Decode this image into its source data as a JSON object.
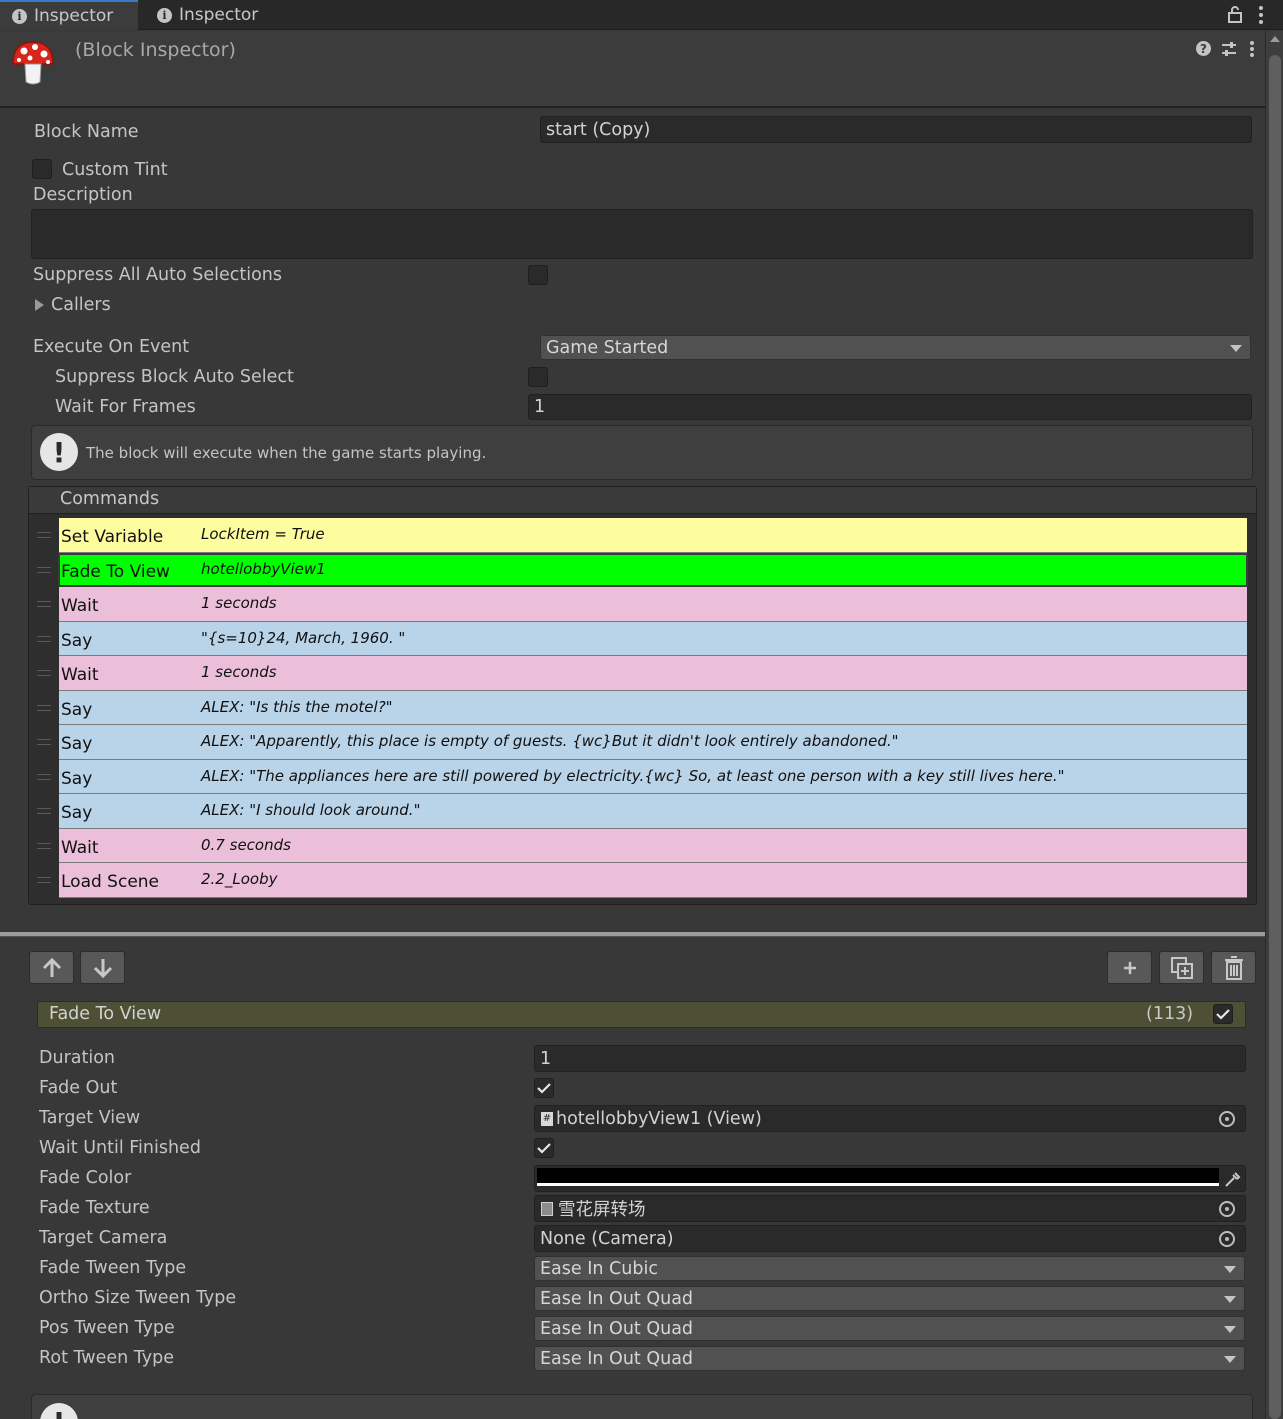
{
  "tabs": [
    {
      "label": "Inspector"
    },
    {
      "label": "Inspector"
    }
  ],
  "header": {
    "title": "(Block Inspector)"
  },
  "block": {
    "block_name_label": "Block Name",
    "block_name_value": "start (Copy)",
    "custom_tint_label": "Custom Tint",
    "description_label": "Description",
    "description_value": "",
    "suppress_all_label": "Suppress All Auto Selections",
    "callers_label": "Callers",
    "execute_on_event_label": "Execute On Event",
    "execute_on_event_value": "Game Started",
    "suppress_block_label": "Suppress Block Auto Select",
    "wait_for_frames_label": "Wait For Frames",
    "wait_for_frames_value": "1",
    "help_text": "The block will execute when the game starts playing."
  },
  "commands": {
    "header": "Commands",
    "rows": [
      {
        "name": "Set Variable",
        "summary": "LockItem = True",
        "color": "#fdfda0"
      },
      {
        "name": "Fade To View",
        "summary": "hotellobbyView1",
        "color": "#00ff00"
      },
      {
        "name": "Wait",
        "summary": "1 seconds",
        "color": "#ebbfd9"
      },
      {
        "name": "Say",
        "summary": "\"{s=10}24, March, 1960. \"",
        "color": "#b9d3e9"
      },
      {
        "name": "Wait",
        "summary": "1 seconds",
        "color": "#ebbfd9"
      },
      {
        "name": "Say",
        "summary": "ALEX: \"Is this the motel?\"",
        "color": "#b9d3e9"
      },
      {
        "name": "Say",
        "summary": "ALEX: \"Apparently, this place is empty of guests. {wc}But it didn't look entirely abandoned.\"",
        "color": "#b9d3e9"
      },
      {
        "name": "Say",
        "summary": "ALEX: \"The appliances here are still powered by electricity.{wc} So, at least one person with a key still lives here.\"",
        "color": "#b9d3e9"
      },
      {
        "name": "Say",
        "summary": "ALEX: \"I should look around.\"",
        "color": "#b9d3e9"
      },
      {
        "name": "Wait",
        "summary": "0.7 seconds",
        "color": "#ebbfd9"
      },
      {
        "name": "Load Scene",
        "summary": "2.2_Looby",
        "color": "#ebbfd9"
      }
    ]
  },
  "selected_command": {
    "title": "Fade To View",
    "index": "(113)",
    "fields": {
      "duration_label": "Duration",
      "duration_value": "1",
      "fade_out_label": "Fade Out",
      "target_view_label": "Target View",
      "target_view_value": "hotellobbyView1 (View)",
      "wait_until_finished_label": "Wait Until Finished",
      "fade_color_label": "Fade Color",
      "fade_color_value": "#000000",
      "fade_texture_label": "Fade Texture",
      "fade_texture_value": "雪花屏转场",
      "target_camera_label": "Target Camera",
      "target_camera_value": "None (Camera)",
      "fade_tween_label": "Fade Tween Type",
      "fade_tween_value": "Ease In Cubic",
      "ortho_tween_label": "Ortho Size Tween Type",
      "ortho_tween_value": "Ease In Out Quad",
      "pos_tween_label": "Pos Tween Type",
      "pos_tween_value": "Ease In Out Quad",
      "rot_tween_label": "Rot Tween Type",
      "rot_tween_value": "Ease In Out Quad"
    }
  },
  "icons": {
    "mushroom": "mushroom-icon",
    "help": "help-icon",
    "presets": "presets-icon",
    "more": "kebab-menu-icon",
    "lock": "lock-icon",
    "up": "arrow-up-icon",
    "down": "arrow-down-icon",
    "add": "plus-icon",
    "duplicate": "duplicate-icon",
    "delete": "trash-icon",
    "eyedropper": "eyedropper-icon"
  }
}
